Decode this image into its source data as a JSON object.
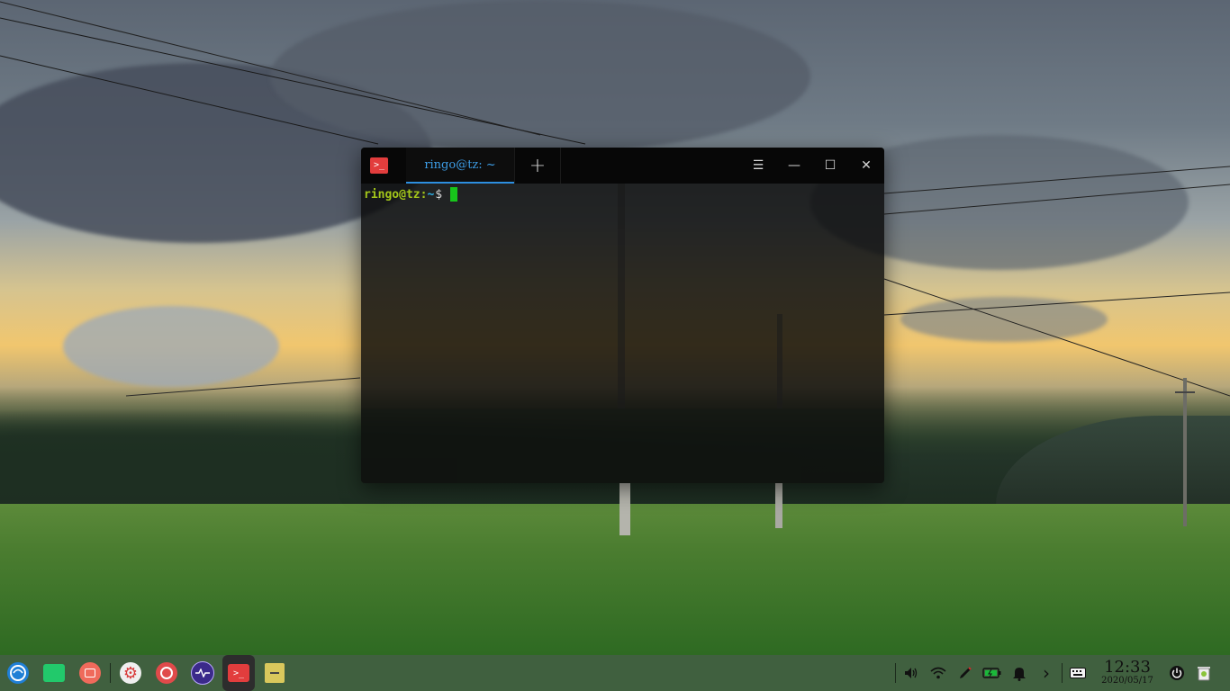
{
  "terminal": {
    "tab_label": "ringo@tz: ~",
    "new_tab_symbol": "+",
    "menu_symbol": "☰",
    "minimize_symbol": "—",
    "maximize_symbol": "☐",
    "close_symbol": "✕",
    "app_icon_symbol": ">_",
    "prompt_user": "ringo@tz",
    "prompt_sep": ":",
    "prompt_path": "~",
    "prompt_symbol": "$"
  },
  "dock": {
    "launcher_icon": "deepin-launcher-icon",
    "apps": [
      {
        "name": "file-manager-icon",
        "color": "#22c96b",
        "symbol": "▤"
      },
      {
        "name": "screen-recorder-icon",
        "color": "#ef6a5b",
        "symbol": "▮"
      },
      {
        "name": "settings-icon",
        "color": "#8a8a8a",
        "symbol": "⚙"
      },
      {
        "name": "music-icon",
        "color": "#e04a4a",
        "symbol": "●"
      },
      {
        "name": "system-monitor-icon",
        "color": "#4a2ea8",
        "symbol": "∿"
      },
      {
        "name": "terminal-icon",
        "color": "#e23d3d",
        "symbol": ">_"
      },
      {
        "name": "archive-manager-icon",
        "color": "#d9c85c",
        "symbol": "▭"
      }
    ]
  },
  "tray": {
    "volume_icon": "🔊",
    "wifi_icon": "📶",
    "pen_icon": "✎",
    "battery_icon": "▭",
    "notification_icon": "🔔",
    "expand_icon": "›",
    "keyboard_icon": "⌨",
    "time": "12:33",
    "date": "2020/05/17",
    "power_icon": "⏻",
    "trash_icon": "🗑"
  },
  "colors": {
    "accent": "#2d8fe0",
    "prompt_green": "#a3c61a",
    "cursor": "#17c61b",
    "dock_bg": "#426042"
  }
}
